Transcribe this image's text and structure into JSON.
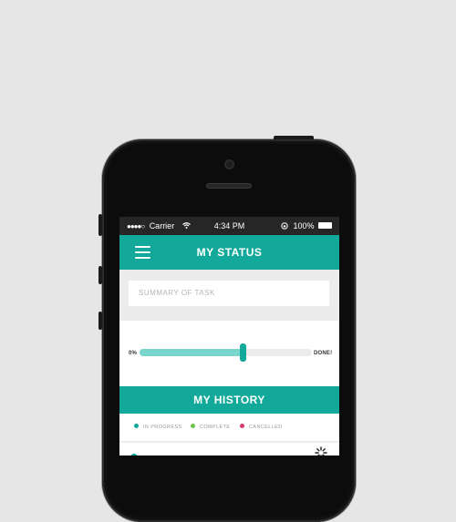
{
  "statusbar": {
    "signal_dots": "●●●●○",
    "carrier": "Carrier",
    "time": "4:34 PM",
    "battery": "100%"
  },
  "header": {
    "title": "MY STATUS"
  },
  "task": {
    "placeholder": "SUMMARY OF TASK"
  },
  "progress": {
    "start_label": "0%",
    "end_label": "DONE!",
    "value": 0.6
  },
  "history": {
    "title": "MY HISTORY",
    "legend": [
      {
        "label": "IN PROGRESS",
        "color": "#12a99a"
      },
      {
        "label": "COMPLETE",
        "color": "#6cc24a"
      },
      {
        "label": "CANCELLED",
        "color": "#d63a6e"
      }
    ]
  },
  "colors": {
    "accent": "#12a99a",
    "accent_light": "#78d5cb"
  }
}
